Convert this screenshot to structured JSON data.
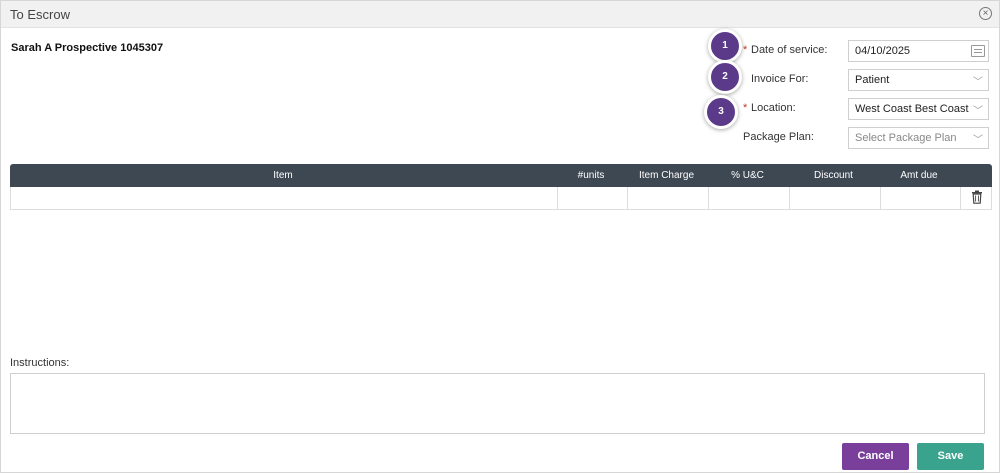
{
  "dialog": {
    "title": "To Escrow"
  },
  "patient": {
    "name": "Sarah A Prospective 1045307"
  },
  "form": {
    "date_label": "Date of service:",
    "date_value": "04/10/2025",
    "invoice_label": "Invoice For:",
    "invoice_value": "Patient",
    "location_label": "Location:",
    "location_value": "West Coast Best Coast",
    "package_label": "Package Plan:",
    "package_placeholder": "Select Package Plan",
    "required_mark": "*"
  },
  "badges": [
    "1",
    "2",
    "3"
  ],
  "table": {
    "columns": [
      "Item",
      "#units",
      "Item Charge",
      "% U&C",
      "Discount",
      "Amt due"
    ]
  },
  "instructions": {
    "label": "Instructions:",
    "value": ""
  },
  "buttons": {
    "cancel": "Cancel",
    "save": "Save"
  },
  "colors": {
    "header": "#3e4853",
    "cancel": "#7a3f9b",
    "save": "#3aa38d",
    "badge": "#5b3a8a",
    "required": "#c0392b"
  }
}
